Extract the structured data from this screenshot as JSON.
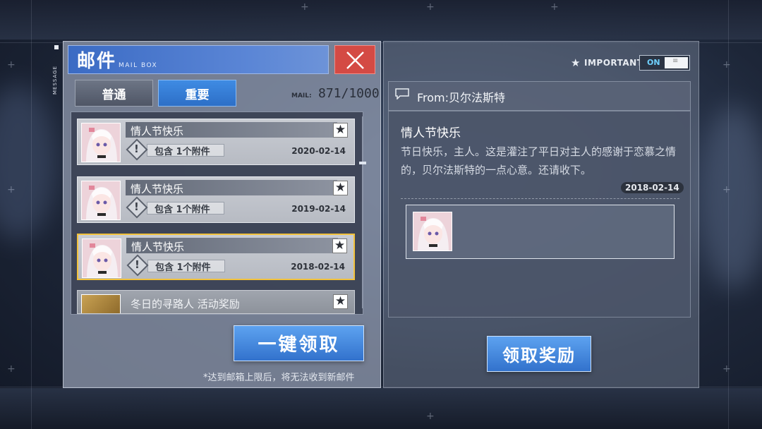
{
  "window": {
    "title": "邮件",
    "subtitle": "MAIL BOX",
    "side_label": "MESSAGE"
  },
  "tabs": [
    {
      "label": "普通",
      "active": false
    },
    {
      "label": "重要",
      "active": true
    }
  ],
  "mail_counter": {
    "label": "MAIL:",
    "value": "871/1000"
  },
  "mail_list": [
    {
      "title": "情人节快乐",
      "attachment": "包含 1个附件",
      "date": "2020-02-14",
      "selected": false
    },
    {
      "title": "情人节快乐",
      "attachment": "包含 1个附件",
      "date": "2019-02-14",
      "selected": false
    },
    {
      "title": "情人节快乐",
      "attachment": "包含 1个附件",
      "date": "2018-02-14",
      "selected": true
    },
    {
      "title": "冬日的寻路人 活动奖励",
      "attachment": "",
      "date": "",
      "selected": false
    }
  ],
  "buttons": {
    "claim_all": "一键领取",
    "claim": "领取奖励"
  },
  "footnote": "*达到邮箱上限后，将无法收到新邮件",
  "important_toggle": {
    "label": "IMPORTANT",
    "state": "ON"
  },
  "detail": {
    "from": "From:贝尔法斯特",
    "title": "情人节快乐",
    "body": "节日快乐，主人。这是灌注了平日对主人的感谢于恋慕之情的，贝尔法斯特的一点心意。还请收下。",
    "date": "2018-02-14"
  },
  "colors": {
    "accent_blue": "#3b6bc4",
    "close_red": "#d44a44",
    "selected_border": "#f2c23c",
    "toggle_on": "#6fd1ff"
  },
  "icons": {
    "close": "close-icon",
    "star": "star-icon",
    "attachment": "exclamation-diamond-icon",
    "chat": "chat-bubble-icon"
  }
}
